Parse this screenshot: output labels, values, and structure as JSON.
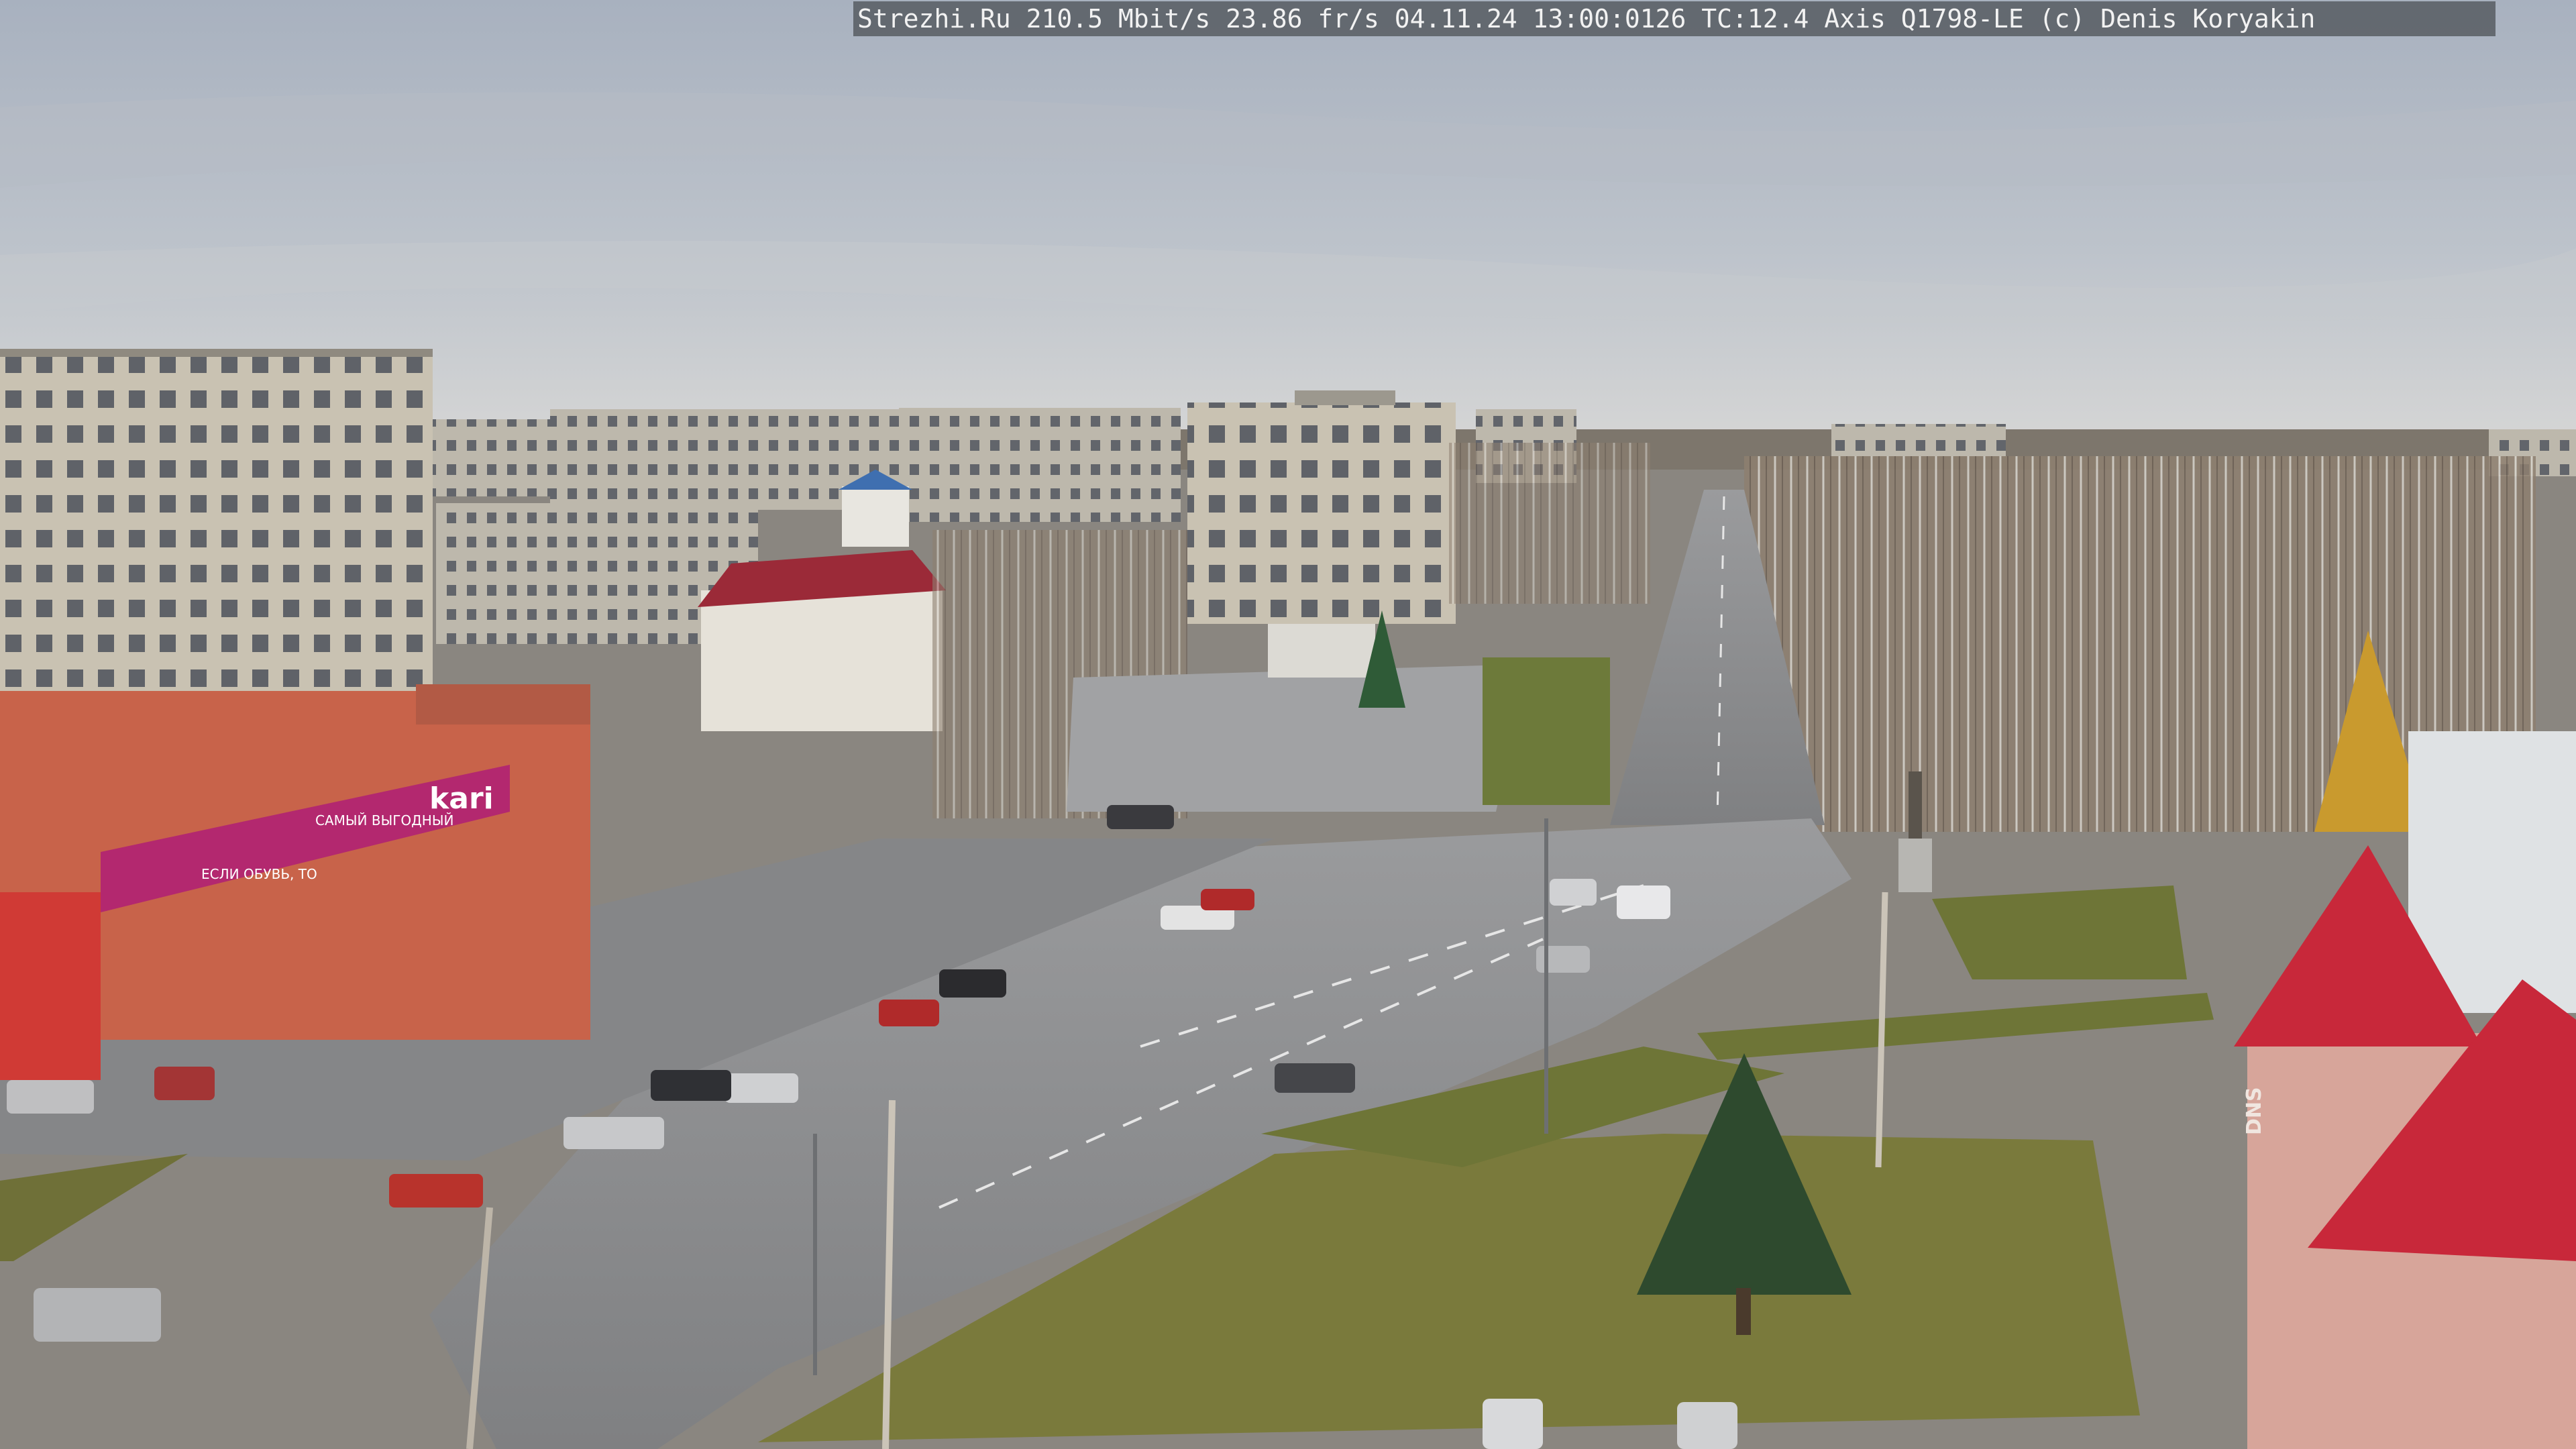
{
  "camera_overlay": {
    "text": "Strezhi.Ru 210.5 Mbit/s 23.86 fr/s 04.11.24 13:00:0126 TC:12.4  Axis Q1798-LE  (c) Denis Koryakin"
  },
  "signage": {
    "store_logo": "kari",
    "store_slogan": "САМЫЙ ВЫГОДНЫЙ",
    "store_banner": "ЕСЛИ ОБУВЬ, ТО",
    "right_building_brand": "DNS"
  },
  "palette": {
    "sky_top": "#a9b3c2",
    "sky_horizon": "#d4d6d8",
    "asphalt": "#8b8c8e",
    "grass": "#7a7a3c",
    "kari_magenta": "#b3286f",
    "roof_red": "#c8283a"
  }
}
